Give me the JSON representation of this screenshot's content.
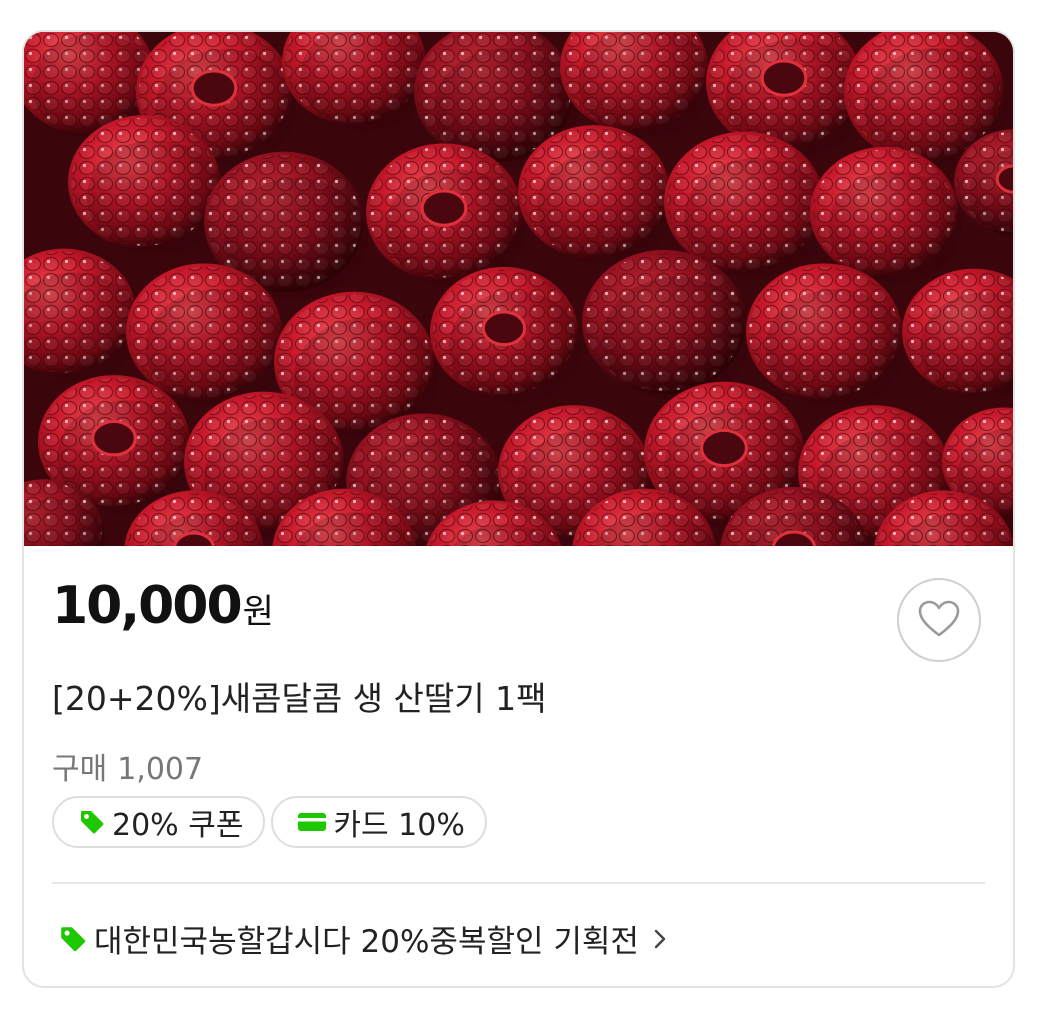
{
  "product": {
    "image_alt": "산딸기",
    "price_value": "10,000",
    "price_unit": "원",
    "title": "[20+20%]새콤달콤 생 산딸기 1팩",
    "purchase_label": "구매",
    "purchase_count": "1,007"
  },
  "badges": [
    {
      "icon": "tag-icon",
      "label": "20% 쿠폰"
    },
    {
      "icon": "card-icon",
      "label": "카드 10%"
    }
  ],
  "promotion": {
    "icon": "tag-icon",
    "label": "대한민국농할갑시다 20%중복할인 기획전",
    "chevron": "chevron-right-icon"
  },
  "like": {
    "icon": "heart-outline-icon"
  },
  "colors": {
    "accent_green": "#1ec800",
    "border": "#e3e3e3",
    "text_primary": "#222222",
    "text_secondary": "#777777",
    "berry_red": "#b0141f"
  }
}
